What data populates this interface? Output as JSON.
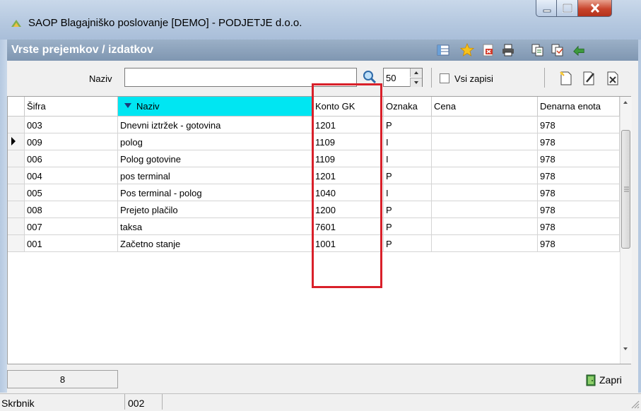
{
  "window": {
    "title": "SAOP Blagajniško poslovanje [DEMO] - PODJETJE d.o.o."
  },
  "form": {
    "title": "Vrste prejemkov / izdatkov"
  },
  "toolbar": {
    "naziv_label": "Naziv",
    "search_value": "",
    "limit_value": "50",
    "show_all_label": "Vsi zapisi",
    "show_all_checked": false
  },
  "grid": {
    "columns": [
      "Šifra",
      "Naziv",
      "Konto GK",
      "Oznaka",
      "Cena",
      "Denarna enota"
    ],
    "sorted_column": "Naziv",
    "current_row_index": 1,
    "rows": [
      {
        "sifra": "003",
        "naziv": "Dnevni iztržek - gotovina",
        "konto": "1201",
        "oznaka": "P",
        "cena": "",
        "enota": "978"
      },
      {
        "sifra": "009",
        "naziv": "polog",
        "konto": "1109",
        "oznaka": "I",
        "cena": "",
        "enota": "978"
      },
      {
        "sifra": "006",
        "naziv": "Polog gotovine",
        "konto": "1109",
        "oznaka": "I",
        "cena": "",
        "enota": "978"
      },
      {
        "sifra": "004",
        "naziv": "pos terminal",
        "konto": "1201",
        "oznaka": "P",
        "cena": "",
        "enota": "978"
      },
      {
        "sifra": "005",
        "naziv": "Pos terminal - polog",
        "konto": "1040",
        "oznaka": "I",
        "cena": "",
        "enota": "978"
      },
      {
        "sifra": "008",
        "naziv": "Prejeto plačilo",
        "konto": "1200",
        "oznaka": "P",
        "cena": "",
        "enota": "978"
      },
      {
        "sifra": "007",
        "naziv": "taksa",
        "konto": "7601",
        "oznaka": "P",
        "cena": "",
        "enota": "978"
      },
      {
        "sifra": "001",
        "naziv": "Začetno stanje",
        "konto": "1001",
        "oznaka": "P",
        "cena": "",
        "enota": "978"
      }
    ]
  },
  "footer": {
    "record_count": "8",
    "close_label": "Zapri"
  },
  "status": {
    "user_label": "Skrbnik",
    "user_value": "002"
  },
  "colors": {
    "sorted_header": "#00e6f2",
    "highlight": "#d9202a",
    "form_header": "#8aa0ba"
  }
}
